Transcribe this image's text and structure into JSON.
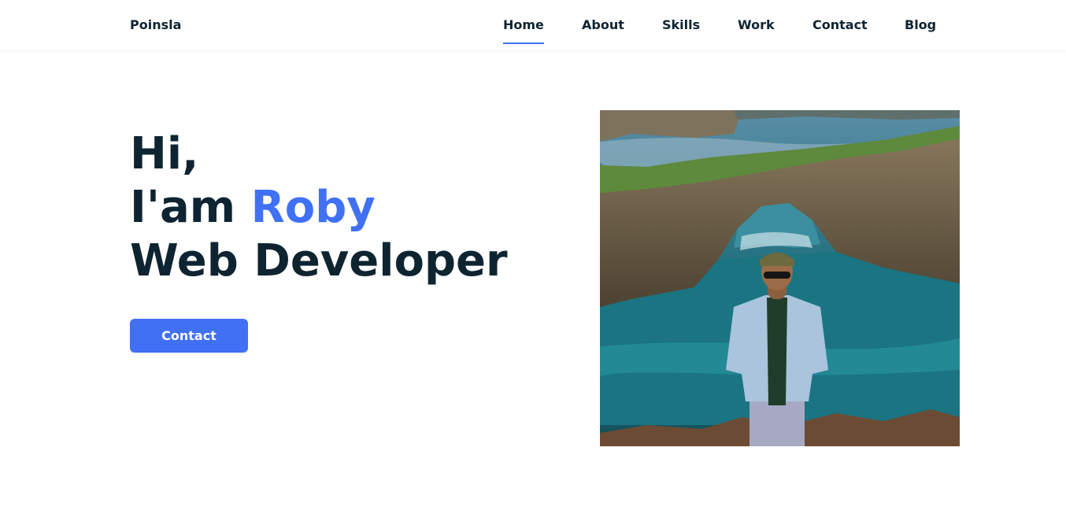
{
  "header": {
    "logo": "Poinsla",
    "nav": [
      {
        "label": "Home",
        "active": true
      },
      {
        "label": "About"
      },
      {
        "label": "Skills"
      },
      {
        "label": "Work"
      },
      {
        "label": "Contact"
      },
      {
        "label": "Blog"
      }
    ]
  },
  "hero": {
    "line1": "Hi,",
    "line2_prefix": "I'am ",
    "line2_name": "Roby",
    "line3": "Web Developer",
    "cta_label": "Contact"
  },
  "colors": {
    "accent": "#4070f4",
    "text": "#0e2431"
  },
  "icons": {
    "photo": "profile-photo"
  }
}
